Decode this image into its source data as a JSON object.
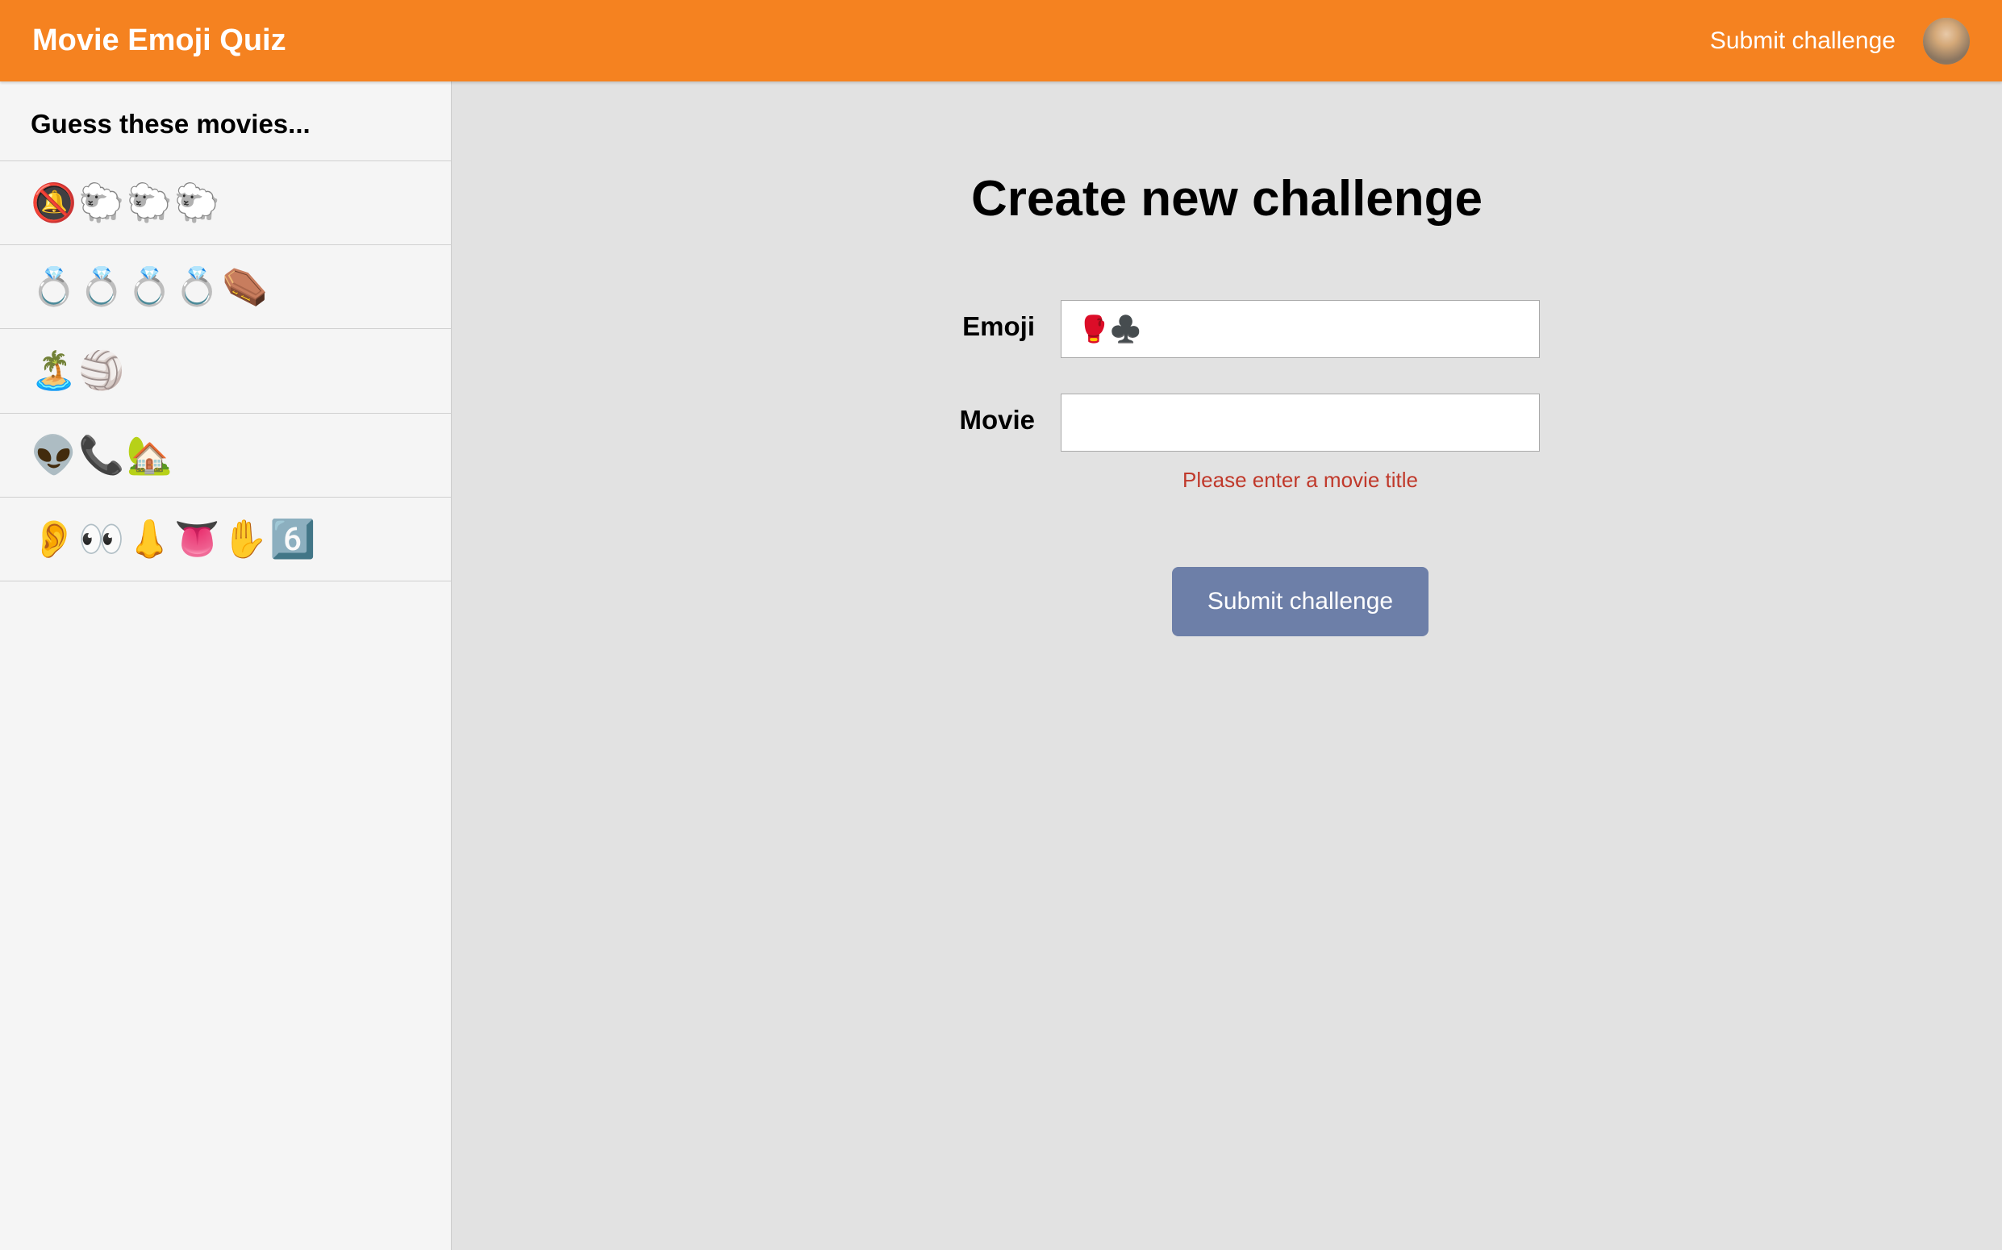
{
  "header": {
    "app_title": "Movie Emoji Quiz",
    "submit_link": "Submit challenge"
  },
  "sidebar": {
    "heading": "Guess these movies...",
    "items": [
      {
        "emojis": "🔕🐑🐑🐑"
      },
      {
        "emojis": "💍💍💍💍⚰️"
      },
      {
        "emojis": "🏝️🏐"
      },
      {
        "emojis": "👽📞🏡"
      },
      {
        "emojis": "👂👀👃👅✋6️⃣"
      }
    ]
  },
  "main": {
    "title": "Create new challenge",
    "form": {
      "emoji_label": "Emoji",
      "emoji_value": "🥊♣️",
      "movie_label": "Movie",
      "movie_value": "",
      "movie_error": "Please enter a movie title",
      "submit_label": "Submit challenge"
    }
  }
}
